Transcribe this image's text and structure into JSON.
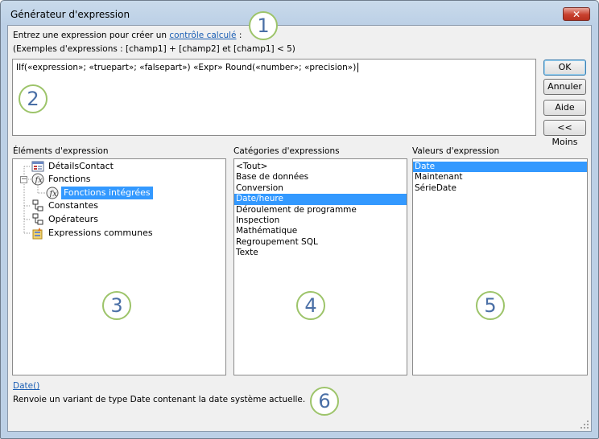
{
  "window": {
    "title": "Générateur d'expression",
    "close_glyph": "✕"
  },
  "intro": {
    "text": "Entrez une expression pour créer un ",
    "link": "contrôle calculé",
    "suffix": " :"
  },
  "examples": "(Exemples d'expressions : [champ1] + [champ2] et [champ1] < 5)",
  "expression": {
    "value": "IIf(«expression»; «truepart»; «falsepart») «Expr» Round(«number»; «precision»)"
  },
  "buttons": {
    "ok": "OK",
    "cancel": "Annuler",
    "help": "Aide",
    "less": "<< Moins"
  },
  "sections": {
    "elements_label": "Éléments d'expression",
    "categories_label": "Catégories d'expressions",
    "values_label": "Valeurs d'expression"
  },
  "tree": {
    "items": [
      {
        "label": "DétailsContact",
        "icon": "form-icon"
      },
      {
        "label": "Fonctions",
        "icon": "function-icon"
      },
      {
        "label": "Fonctions intégrées",
        "icon": "function-icon",
        "selected": true
      },
      {
        "label": "Constantes",
        "icon": "constants-icon"
      },
      {
        "label": "Opérateurs",
        "icon": "operators-icon"
      },
      {
        "label": "Expressions communes",
        "icon": "common-expressions-icon"
      }
    ]
  },
  "categories": [
    "<Tout>",
    "Base de données",
    "Conversion",
    "Date/heure",
    "Déroulement de programme",
    "Inspection",
    "Mathématique",
    "Regroupement SQL",
    "Texte"
  ],
  "categories_selected": "Date/heure",
  "values": [
    "Date",
    "Maintenant",
    "SérieDate"
  ],
  "values_selected": "Date",
  "footer": {
    "link": "Date()",
    "description": "Renvoie un variant de type Date contenant la date système actuelle."
  },
  "callouts": [
    "1",
    "2",
    "3",
    "4",
    "5",
    "6"
  ],
  "colors": {
    "selection": "#3399ff",
    "link": "#1a5eb4",
    "callout_border": "#9dc46a",
    "callout_text": "#4a6fa6"
  }
}
